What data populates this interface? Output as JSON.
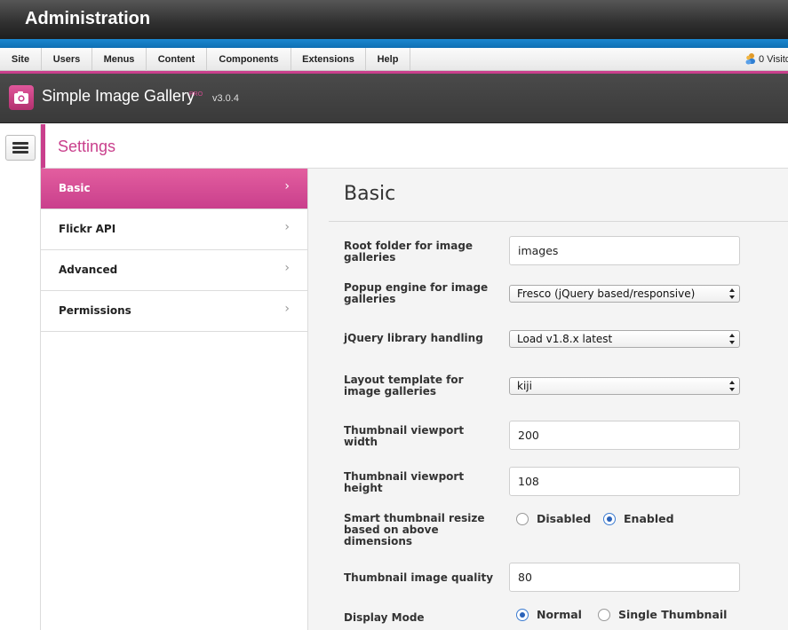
{
  "admin": {
    "title": "Administration"
  },
  "menu": {
    "items": [
      {
        "label": "Site"
      },
      {
        "label": "Users"
      },
      {
        "label": "Menus"
      },
      {
        "label": "Content"
      },
      {
        "label": "Components"
      },
      {
        "label": "Extensions"
      },
      {
        "label": "Help"
      }
    ],
    "visitors": "0 Visito"
  },
  "component": {
    "title": "Simple Image Gallery",
    "badge": "PRO",
    "version": "v3.0.4",
    "logo_icon": "camera-icon"
  },
  "settings": {
    "title": "Settings",
    "nav": [
      {
        "label": "Basic",
        "active": true
      },
      {
        "label": "Flickr API",
        "active": false
      },
      {
        "label": "Advanced",
        "active": false
      },
      {
        "label": "Permissions",
        "active": false
      }
    ]
  },
  "basic": {
    "title": "Basic",
    "fields": {
      "root_folder": {
        "label": "Root folder for image galleries",
        "value": "images"
      },
      "popup_engine": {
        "label": "Popup engine for image galleries",
        "value": "Fresco (jQuery based/responsive)"
      },
      "jquery_handling": {
        "label": "jQuery library handling",
        "value": "Load v1.8.x latest"
      },
      "layout_template": {
        "label": "Layout template for image galleries",
        "value": "kiji"
      },
      "thumb_width": {
        "label": "Thumbnail viewport width",
        "value": "200"
      },
      "thumb_height": {
        "label": "Thumbnail viewport height",
        "value": "108"
      },
      "smart_resize": {
        "label": "Smart thumbnail resize based on above dimensions",
        "options": [
          {
            "label": "Disabled",
            "checked": false
          },
          {
            "label": "Enabled",
            "checked": true
          }
        ]
      },
      "thumb_quality": {
        "label": "Thumbnail image quality",
        "value": "80"
      },
      "display_mode": {
        "label": "Display Mode",
        "options": [
          {
            "label": "Normal",
            "checked": true
          },
          {
            "label": "Single Thumbnail",
            "checked": false
          }
        ]
      }
    }
  },
  "colors": {
    "accent": "#c93f8c",
    "blue": "#1b87d0",
    "header_dark": "#3a3a3a"
  }
}
